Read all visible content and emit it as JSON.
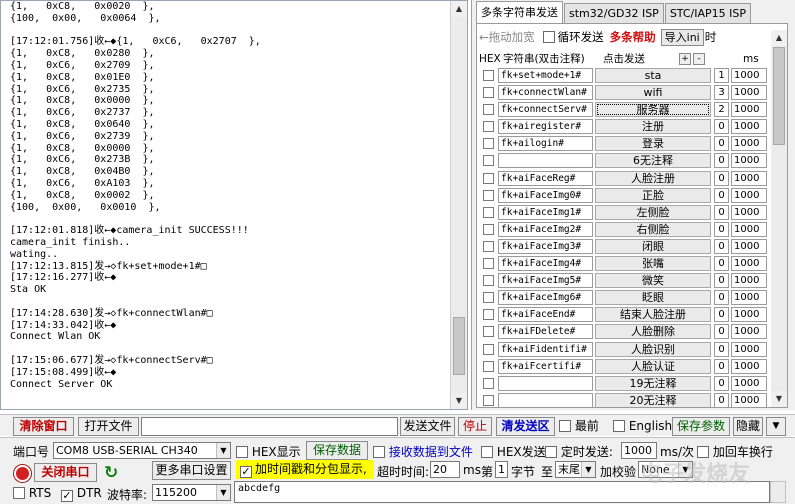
{
  "log_lines": [
    "{1,   0xC8,   0x0020  },",
    "{100,  0x00,   0x0064  },",
    "",
    "[17:12:01.756]收←◆{1,   0xC6,   0x2707  },",
    "{1,   0xC8,   0x0280  },",
    "{1,   0xC6,   0x2709  },",
    "{1,   0xC8,   0x01E0  },",
    "{1,   0xC6,   0x2735  },",
    "{1,   0xC8,   0x0000  },",
    "{1,   0xC6,   0x2737  },",
    "{1,   0xC8,   0x0640  },",
    "{1,   0xC6,   0x2739  },",
    "{1,   0xC8,   0x0000  },",
    "{1,   0xC6,   0x273B  },",
    "{1,   0xC8,   0x04B0  },",
    "{1,   0xC6,   0xA103  },",
    "{1,   0xC8,   0x0002  },",
    "{100,  0x00,   0x0010  },",
    "",
    "[17:12:01.818]收←◆camera_init SUCCESS!!!",
    "camera_init finish..",
    "wating..",
    "[17:12:13.815]发→◇fk+set+mode+1#□",
    "[17:12:16.277]收←◆",
    "Sta OK",
    "",
    "[17:14:28.630]发→◇fk+connectWlan#□",
    "[17:14:33.042]收←◆",
    "Connect Wlan OK",
    "",
    "[17:15:06.677]发→◇fk+connectServ#□",
    "[17:15:08.499]收←◆",
    "Connect Server OK"
  ],
  "tabs": [
    {
      "label": "多条字符串发送"
    },
    {
      "label": "stm32/GD32 ISP"
    },
    {
      "label": "STC/IAP15 ISP"
    }
  ],
  "multi": {
    "drag_label": "←拖动加宽",
    "loop_label": "循环发送",
    "help_label": "多条帮助",
    "import_label": "导入ini",
    "time_suffix": "时",
    "hdr_hex": "HEX",
    "hdr_string": "字符串(双击注释)",
    "hdr_click": "点击发送",
    "hdr_plus": "+",
    "hdr_minus": "-",
    "hdr_ms": "ms",
    "rows": [
      {
        "string": "fk+set+mode+1#",
        "send": "sta",
        "order": "1",
        "delay": "1000"
      },
      {
        "string": "fk+connectWlan#",
        "send": "wifi",
        "order": "3",
        "delay": "1000"
      },
      {
        "string": "fk+connectServ#",
        "send": "服务器",
        "order": "2",
        "delay": "1000"
      },
      {
        "string": "fk+airegister#",
        "send": "注册",
        "order": "0",
        "delay": "1000"
      },
      {
        "string": "fk+ailogin#",
        "send": "登录",
        "order": "0",
        "delay": "1000"
      },
      {
        "string": "",
        "send": "6无注释",
        "order": "0",
        "delay": "1000"
      },
      {
        "string": "fk+aiFaceReg#",
        "send": "人脸注册",
        "order": "0",
        "delay": "1000"
      },
      {
        "string": "fk+aiFaceImg0#",
        "send": "正脸",
        "order": "0",
        "delay": "1000"
      },
      {
        "string": "fk+aiFaceImg1#",
        "send": "左侧脸",
        "order": "0",
        "delay": "1000"
      },
      {
        "string": "fk+aiFaceImg2#",
        "send": "右侧脸",
        "order": "0",
        "delay": "1000"
      },
      {
        "string": "fk+aiFaceImg3#",
        "send": "闭眼",
        "order": "0",
        "delay": "1000"
      },
      {
        "string": "fk+aiFaceImg4#",
        "send": "张嘴",
        "order": "0",
        "delay": "1000"
      },
      {
        "string": "fk+aiFaceImg5#",
        "send": "微笑",
        "order": "0",
        "delay": "1000"
      },
      {
        "string": "fk+aiFaceImg6#",
        "send": "眨眼",
        "order": "0",
        "delay": "1000"
      },
      {
        "string": "fk+aiFaceEnd#",
        "send": "结束人脸注册",
        "order": "0",
        "delay": "1000"
      },
      {
        "string": "fk+aiFDelete#",
        "send": "人脸删除",
        "order": "0",
        "delay": "1000"
      },
      {
        "string": "fk+aiFidentifi#",
        "send": "人脸识别",
        "order": "0",
        "delay": "1000"
      },
      {
        "string": "fk+aiFcertifi#",
        "send": "人脸认证",
        "order": "0",
        "delay": "1000"
      },
      {
        "string": "",
        "send": "19无注释",
        "order": "0",
        "delay": "1000"
      },
      {
        "string": "",
        "send": "20无注释",
        "order": "0",
        "delay": "1000"
      }
    ]
  },
  "mid_toolbar": {
    "clear_window": "清除窗口",
    "open_file": "打开文件",
    "send_file": "发送文件",
    "stop": "停止",
    "clear_send": "清发送区",
    "latest": "最前",
    "english": "English",
    "save_params": "保存参数",
    "hide": "隐藏"
  },
  "bottom": {
    "port_label": "端口号",
    "port_value": "COM8 USB-SERIAL CH340",
    "hex_display": "HEX显示",
    "save_data": "保存数据",
    "recv_to_file": "接收数据到文件",
    "hex_send": "HEX发送",
    "timed_send": "定时发送:",
    "timed_value": "1000",
    "timed_unit": "ms/次",
    "add_crlf": "加回车换行",
    "close_port": "关闭串口",
    "more_settings": "更多串口设置",
    "timestamp_label": "加时间戳和分包显示,",
    "timeout_label": "超时时间:",
    "timeout_value": "20",
    "timeout_unit": "ms",
    "nth_label": "第",
    "nth_value": "1",
    "byte_label": "字节",
    "to_label": "至",
    "to_value": "末尾",
    "checksum_label": "加校验",
    "checksum_value": "None",
    "rts_label": "RTS",
    "dtr_label": "DTR",
    "baud_label": "波特率:",
    "baud_value": "115200",
    "send_text": "abcdefg"
  },
  "watermark": "电子发烧友",
  "colors": {
    "help_red": "#d01010",
    "timestamp_highlight": "#ffff00",
    "record_red": "#d02020"
  }
}
